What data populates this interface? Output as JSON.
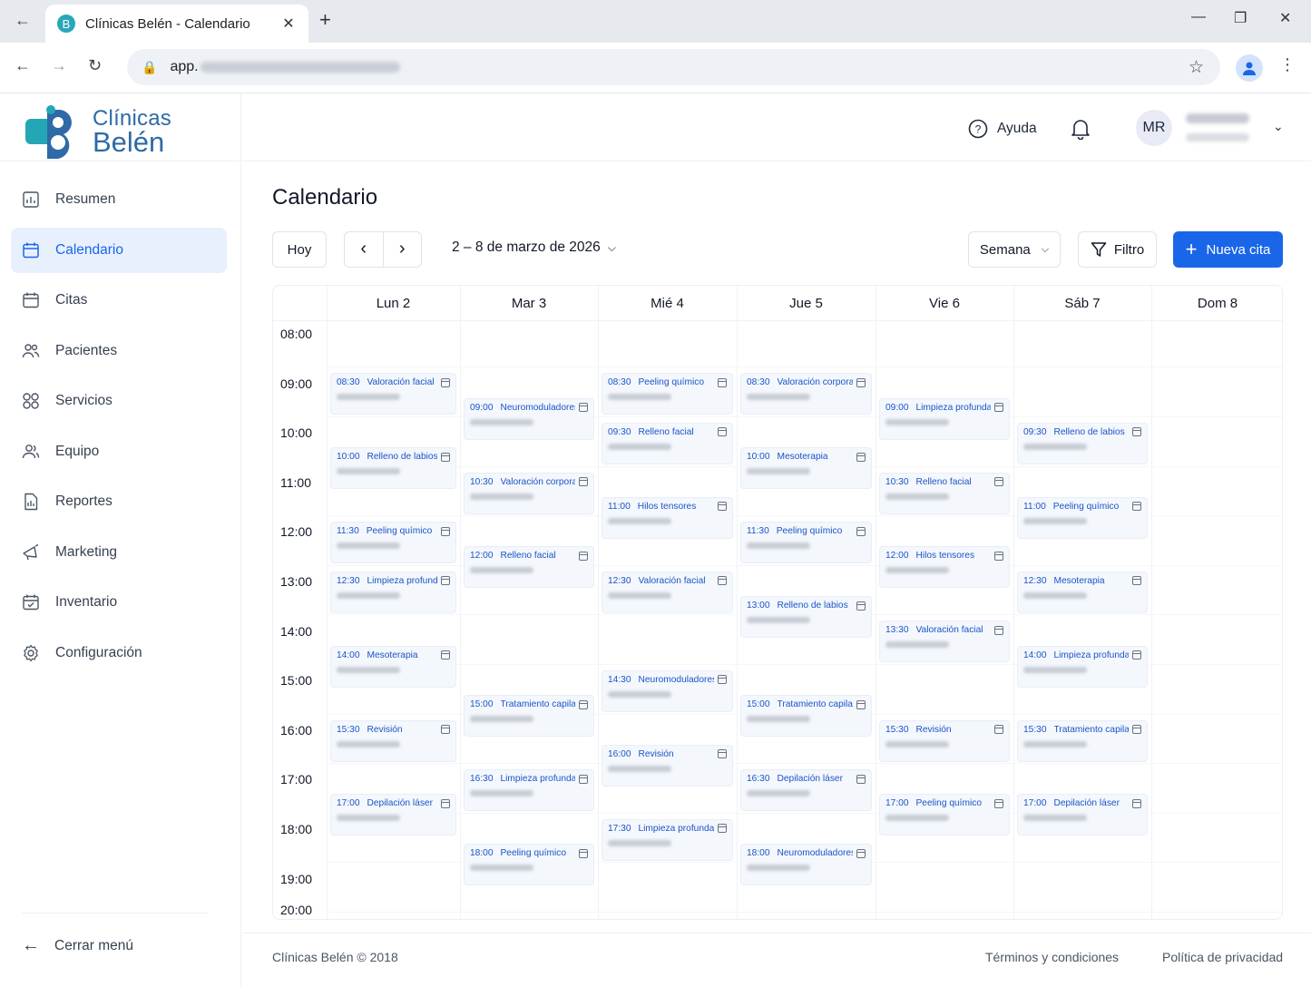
{
  "browser": {
    "tab_title": "Clínicas Belén - Calendario",
    "url_prefix": "app."
  },
  "brand": {
    "line1": "Clínicas",
    "line2": "Belén",
    "accent": "#1a66e8",
    "logo_color": "#2e6aa6"
  },
  "sidebar": {
    "items": [
      {
        "label": "Resumen",
        "icon": "dashboard-icon"
      },
      {
        "label": "Calendario",
        "icon": "calendar-icon",
        "active": true
      },
      {
        "label": "Citas",
        "icon": "appointments-icon"
      },
      {
        "label": "Pacientes",
        "icon": "patients-icon"
      },
      {
        "label": "Servicios",
        "icon": "services-icon"
      },
      {
        "label": "Equipo",
        "icon": "team-icon"
      },
      {
        "label": "Reportes",
        "icon": "reports-icon"
      },
      {
        "label": "Marketing",
        "icon": "marketing-icon"
      },
      {
        "label": "Inventario",
        "icon": "inventory-icon"
      },
      {
        "label": "Configuración",
        "icon": "settings-icon"
      }
    ],
    "close_label": "Cerrar menú"
  },
  "header": {
    "help_label": "Ayuda",
    "avatar_initials": "MR"
  },
  "main": {
    "title": "Calendario",
    "today_label": "Hoy",
    "prev_symbol": "‹",
    "next_symbol": "›",
    "range_label": "2 – 8 de marzo de 2026",
    "view_label": "Semana",
    "filter_label": "Filtro",
    "new_label": "Nueva cita"
  },
  "calendar": {
    "days": [
      "Lun 2",
      "Mar 3",
      "Mié 4",
      "Jue 5",
      "Vie 6",
      "Sáb 7",
      "Dom 8"
    ],
    "hours": [
      "08:00",
      "09:00",
      "10:00",
      "11:00",
      "12:00",
      "13:00",
      "14:00",
      "15:00",
      "16:00",
      "17:00",
      "18:00",
      "19:00",
      "20:00"
    ],
    "events": [
      {
        "day": 0,
        "time": "08:30",
        "service": "Valoración facial"
      },
      {
        "day": 0,
        "time": "10:00",
        "service": "Relleno de labios"
      },
      {
        "day": 0,
        "time": "11:30",
        "service": "Peeling químico"
      },
      {
        "day": 0,
        "time": "12:30",
        "service": "Limpieza profunda"
      },
      {
        "day": 0,
        "time": "14:00",
        "service": "Mesoterapia"
      },
      {
        "day": 0,
        "time": "15:30",
        "service": "Revisión"
      },
      {
        "day": 0,
        "time": "17:00",
        "service": "Depilación láser"
      },
      {
        "day": 1,
        "time": "09:00",
        "service": "Neuromoduladores"
      },
      {
        "day": 1,
        "time": "10:30",
        "service": "Valoración corporal"
      },
      {
        "day": 1,
        "time": "12:00",
        "service": "Relleno facial"
      },
      {
        "day": 1,
        "time": "15:00",
        "service": "Tratamiento capilar"
      },
      {
        "day": 1,
        "time": "16:30",
        "service": "Limpieza profunda"
      },
      {
        "day": 1,
        "time": "18:00",
        "service": "Peeling químico"
      },
      {
        "day": 2,
        "time": "08:30",
        "service": "Peeling químico"
      },
      {
        "day": 2,
        "time": "09:30",
        "service": "Relleno facial"
      },
      {
        "day": 2,
        "time": "11:00",
        "service": "Hilos tensores"
      },
      {
        "day": 2,
        "time": "12:30",
        "service": "Valoración facial"
      },
      {
        "day": 2,
        "time": "14:30",
        "service": "Neuromoduladores"
      },
      {
        "day": 2,
        "time": "16:00",
        "service": "Revisión"
      },
      {
        "day": 2,
        "time": "17:30",
        "service": "Limpieza profunda"
      },
      {
        "day": 3,
        "time": "08:30",
        "service": "Valoración corporal"
      },
      {
        "day": 3,
        "time": "10:00",
        "service": "Mesoterapia"
      },
      {
        "day": 3,
        "time": "11:30",
        "service": "Peeling químico"
      },
      {
        "day": 3,
        "time": "13:00",
        "service": "Relleno de labios"
      },
      {
        "day": 3,
        "time": "15:00",
        "service": "Tratamiento capilar"
      },
      {
        "day": 3,
        "time": "16:30",
        "service": "Depilación láser"
      },
      {
        "day": 3,
        "time": "18:00",
        "service": "Neuromoduladores"
      },
      {
        "day": 4,
        "time": "09:00",
        "service": "Limpieza profunda"
      },
      {
        "day": 4,
        "time": "10:30",
        "service": "Relleno facial"
      },
      {
        "day": 4,
        "time": "12:00",
        "service": "Hilos tensores"
      },
      {
        "day": 4,
        "time": "13:30",
        "service": "Valoración facial"
      },
      {
        "day": 4,
        "time": "15:30",
        "service": "Revisión"
      },
      {
        "day": 4,
        "time": "17:00",
        "service": "Peeling químico"
      },
      {
        "day": 5,
        "time": "09:30",
        "service": "Relleno de labios"
      },
      {
        "day": 5,
        "time": "11:00",
        "service": "Peeling químico"
      },
      {
        "day": 5,
        "time": "12:30",
        "service": "Mesoterapia"
      },
      {
        "day": 5,
        "time": "14:00",
        "service": "Limpieza profunda"
      },
      {
        "day": 5,
        "time": "15:30",
        "service": "Tratamiento capilar"
      },
      {
        "day": 5,
        "time": "17:00",
        "service": "Depilación láser"
      }
    ]
  },
  "footer": {
    "copyright": "Clínicas Belén © 2018",
    "terms": "Términos y condiciones",
    "privacy": "Política de privacidad"
  }
}
